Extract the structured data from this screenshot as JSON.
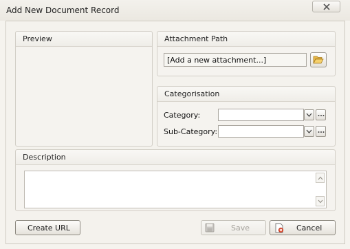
{
  "window": {
    "title": "Add New Document Record"
  },
  "preview": {
    "title": "Preview"
  },
  "attachment": {
    "title": "Attachment Path",
    "value": "[Add a new attachment...]",
    "browse_icon": "folder-open-icon"
  },
  "categorisation": {
    "title": "Categorisation",
    "category_label": "Category:",
    "category_value": "",
    "subcategory_label": "Sub-Category:",
    "subcategory_value": ""
  },
  "description": {
    "title": "Description",
    "value": ""
  },
  "buttons": {
    "create_url": "Create URL",
    "save": "Save",
    "cancel": "Cancel"
  },
  "colors": {
    "panel_border": "#d2cec6",
    "window_bg": "#f5f3ee",
    "disabled_text": "#a6a39d"
  }
}
